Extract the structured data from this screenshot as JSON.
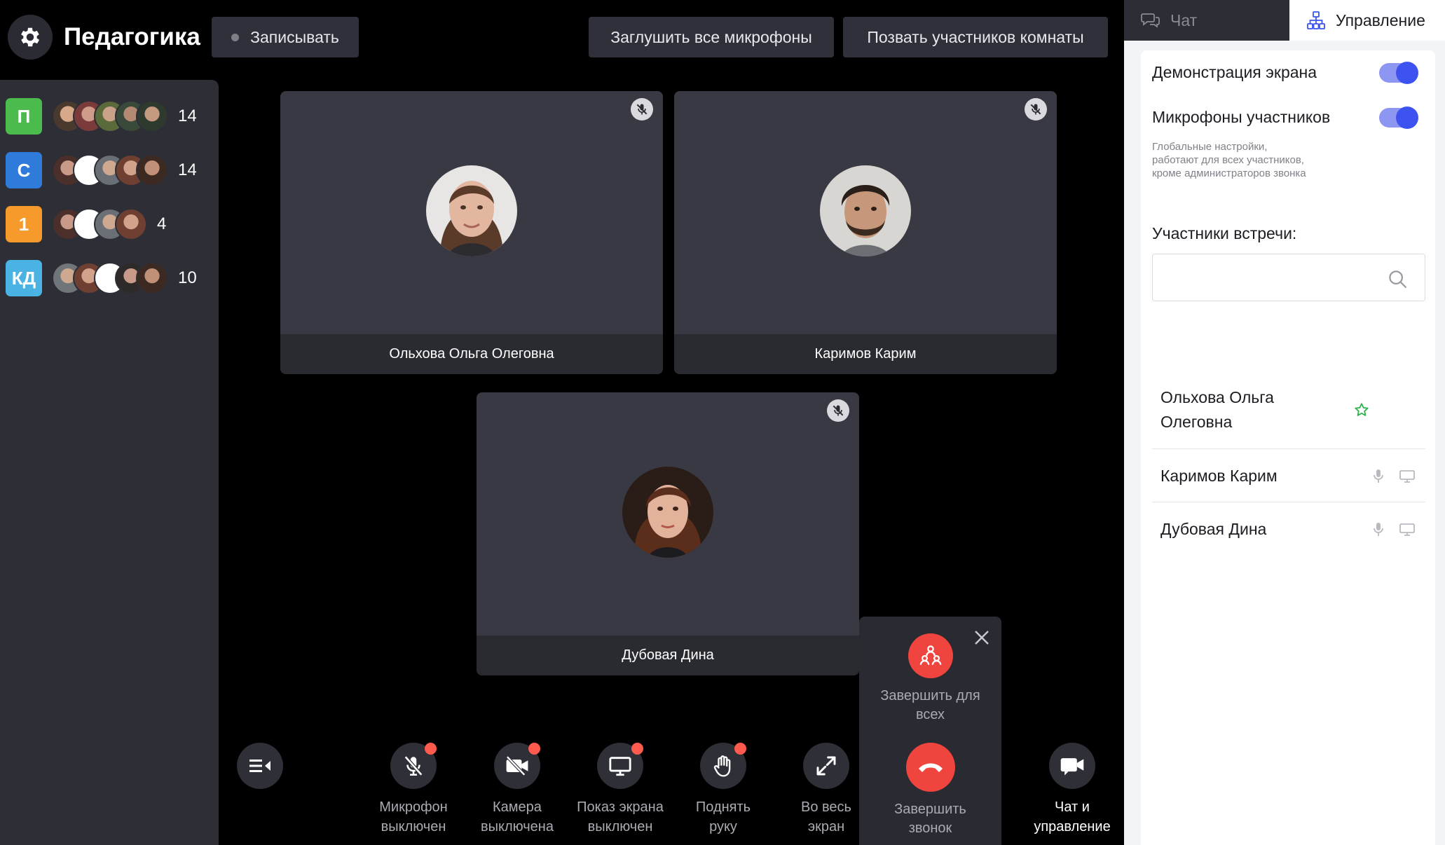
{
  "header": {
    "room_title": "Педагогика",
    "record_label": "Записывать",
    "mute_all_label": "Заглушить все микрофоны",
    "call_room_label": "Позвать участников комнаты"
  },
  "rooms": [
    {
      "badge": "П",
      "color": "#4cbb4d",
      "count": "14"
    },
    {
      "badge": "С",
      "color": "#2f7bd9",
      "count": "14"
    },
    {
      "badge": "1",
      "color": "#f59a2b",
      "count": "4"
    },
    {
      "badge": "КД",
      "color": "#4bb3e3",
      "count": "10"
    }
  ],
  "tiles": [
    {
      "name": "Ольхова Ольга Олеговна"
    },
    {
      "name": "Каримов Карим"
    },
    {
      "name": "Дубовая Дина"
    }
  ],
  "toolbar": {
    "mic_label_1": "Микрофон",
    "mic_label_2": "выключен",
    "cam_label_1": "Камера",
    "cam_label_2": "выключена",
    "screen_label_1": "Показ экрана",
    "screen_label_2": "выключен",
    "hand_label_1": "Поднять",
    "hand_label_2": "руку",
    "full_label_1": "Во весь",
    "full_label_2": "экран",
    "end_all_label_1": "Завершить для",
    "end_all_label_2": "всех",
    "end_call_label_1": "Завершить",
    "end_call_label_2": "звонок",
    "chat_label_1": "Чат и",
    "chat_label_2": "управление"
  },
  "panel": {
    "tab_chat": "Чат",
    "tab_manage": "Управление",
    "screen_share_label": "Демонстрация экрана",
    "mics_label": "Микрофоны участников",
    "hint": "Глобальные настройки, работают для всех участников, кроме администраторов звонка",
    "members_title": "Участники встречи:",
    "search_placeholder": "",
    "members": [
      {
        "name_1": "Ольхова Ольга",
        "name_2": "Олеговна"
      },
      {
        "name": "Каримов Карим"
      },
      {
        "name": "Дубовая Дина"
      }
    ]
  },
  "colors": {
    "accent": "#3d53ef",
    "danger": "#f0453e",
    "star": "#2fb24c"
  }
}
